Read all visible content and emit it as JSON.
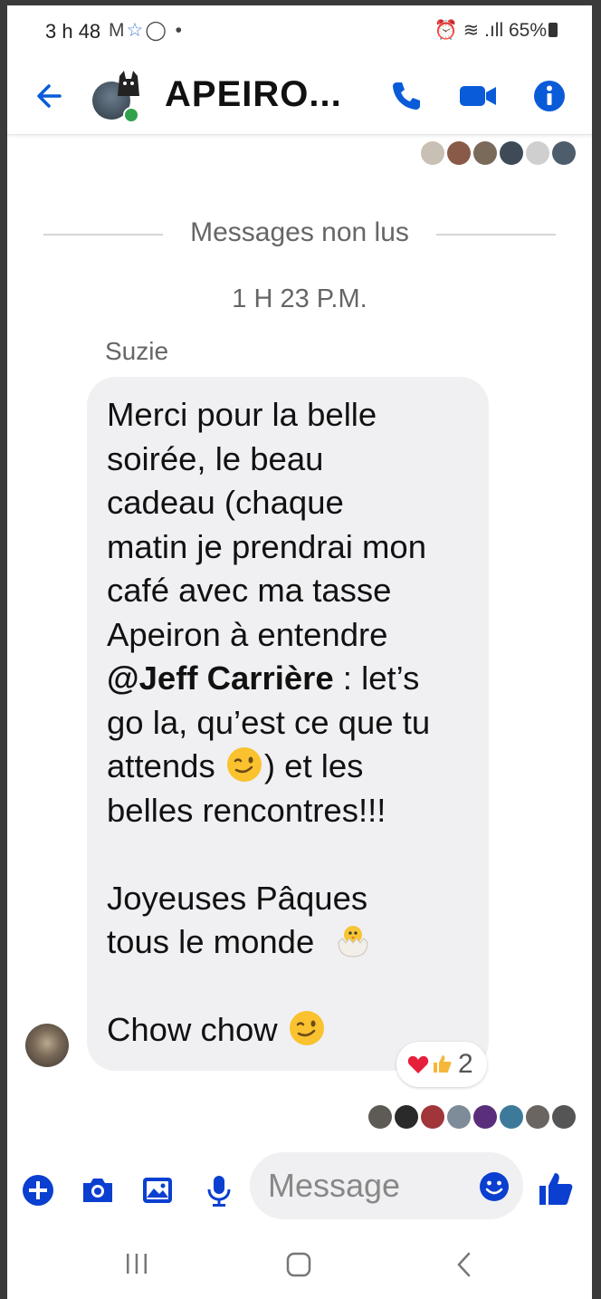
{
  "status_bar": {
    "time": "3 h 48",
    "battery": "65%",
    "icons": [
      "gmail-icon",
      "star-icon",
      "whatsapp-icon",
      "dot-icon",
      "alarm-icon",
      "wifi-icon",
      "signal-icon",
      "battery-icon"
    ]
  },
  "header": {
    "title": "APEIRO...",
    "icons": [
      "back-arrow-icon",
      "phone-icon",
      "video-icon",
      "info-icon"
    ],
    "accent_color": "#0a5bd8"
  },
  "divider": {
    "label": "Messages non lus"
  },
  "timestamp": "1 H 23 P.M.",
  "message": {
    "sender": "Suzie",
    "lines": [
      "Merci pour la belle",
      "soirée, le beau",
      "cadeau (chaque",
      "matin je prendrai mon",
      "café avec ma tasse",
      "Apeiron à entendre"
    ],
    "mention": "@Jeff Carrière",
    "after_mention": " : let’s",
    "lines2": [
      "go la, qu’est ce que tu"
    ],
    "attends_prefix": "attends ",
    "attends_suffix": ") et les",
    "last_line": "belles rencontres!!!",
    "paragraph2_line1": "Joyeuses Pâques",
    "paragraph2_line2": "tous le monde",
    "closing": "Chow chow",
    "emojis": [
      "winking-face-emoji",
      "hatching-chick-emoji",
      "winking-face-emoji"
    ]
  },
  "reactions": {
    "icons": [
      "heart-icon",
      "thumbs-up-icon"
    ],
    "count": "2"
  },
  "composer": {
    "placeholder": "Message",
    "icons": [
      "plus-icon",
      "camera-icon",
      "gallery-icon",
      "microphone-icon",
      "emoji-icon",
      "like-icon"
    ]
  },
  "nav_bar": {
    "icons": [
      "recents-icon",
      "home-icon",
      "back-icon"
    ]
  }
}
